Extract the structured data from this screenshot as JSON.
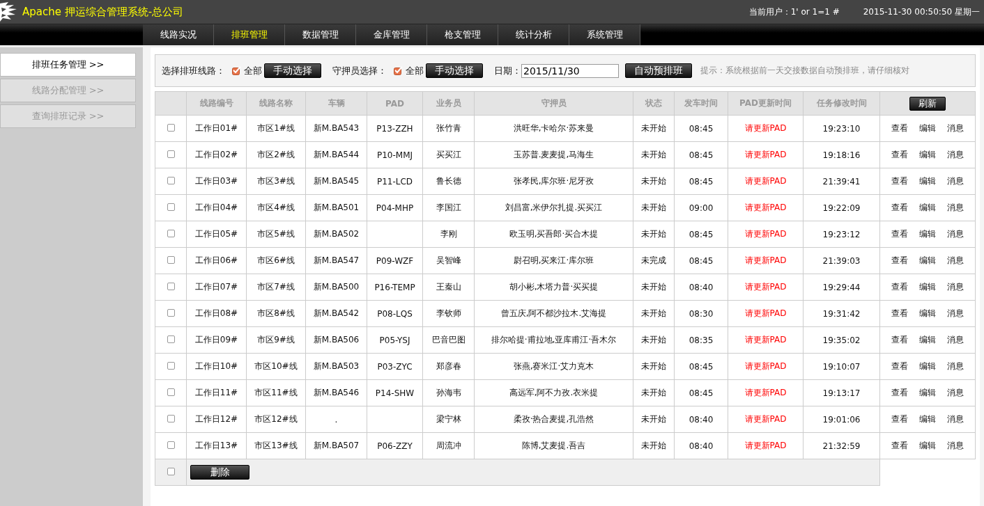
{
  "header": {
    "title": "Apache 押运综合管理系统-总公司",
    "user": "当前用户：1' or 1=1 #",
    "datetime": "2015-11-30 00:50:50 星期一"
  },
  "nav": [
    {
      "label": "线路实况",
      "selected": false
    },
    {
      "label": "排班管理",
      "selected": true
    },
    {
      "label": "数据管理",
      "selected": false
    },
    {
      "label": "金库管理",
      "selected": false
    },
    {
      "label": "枪支管理",
      "selected": false
    },
    {
      "label": "统计分析",
      "selected": false
    },
    {
      "label": "系统管理",
      "selected": false
    }
  ],
  "sidebar": {
    "items": [
      {
        "label": "排班任务管理 >>",
        "selected": true
      },
      {
        "label": "线路分配管理 >>",
        "selected": false
      },
      {
        "label": "查询排班记录 >>",
        "selected": false
      }
    ]
  },
  "filters": {
    "route_label": "选择排班线路：",
    "route_all": {
      "label": "全部",
      "checked": true
    },
    "route_button": "手动选择",
    "guard_label": "守押员选择：",
    "guard_all": {
      "label": "全部",
      "checked": true
    },
    "guard_button": "手动选择",
    "date_label": "日期：",
    "date_value": "2015/11/30",
    "auto_button": "自动预排班",
    "hint": "提示：系统根据前一天交接数据自动预排班，请仔细核对"
  },
  "table": {
    "columns": [
      "线路编号",
      "线路名称",
      "车辆",
      "PAD",
      "业务员",
      "守押员",
      "状态",
      "发车时间",
      "PAD更新时间",
      "任务修改时间"
    ],
    "refresh_button": "刷新",
    "rows": [
      {
        "checked": false,
        "cells": [
          "工作日01#",
          "市区1#线",
          "新M.BA543",
          "P13-ZZH",
          "张竹青",
          "洪旺华,卡哈尔·苏来曼",
          "未开始",
          "08:45",
          "请更新PAD",
          "19:23:10"
        ],
        "actions": [
          "查看",
          "编辑",
          "消息"
        ]
      },
      {
        "checked": false,
        "cells": [
          "工作日02#",
          "市区2#线",
          "新M.BA544",
          "P10-MMJ",
          "买买江",
          "玉苏普.麦麦提,马海生",
          "未开始",
          "08:45",
          "请更新PAD",
          "19:18:16"
        ],
        "actions": [
          "查看",
          "编辑",
          "消息"
        ]
      },
      {
        "checked": false,
        "cells": [
          "工作日03#",
          "市区3#线",
          "新M.BA545",
          "P11-LCD",
          "鲁长德",
          "张孝民,库尔班·尼牙孜",
          "未开始",
          "08:45",
          "请更新PAD",
          "21:39:41"
        ],
        "actions": [
          "查看",
          "编辑",
          "消息"
        ]
      },
      {
        "checked": false,
        "cells": [
          "工作日04#",
          "市区4#线",
          "新M.BA501",
          "P04-MHP",
          "李国江",
          "刘昌富,米伊尔扎提.买买江",
          "未开始",
          "09:00",
          "请更新PAD",
          "19:22:09"
        ],
        "actions": [
          "查看",
          "编辑",
          "消息"
        ]
      },
      {
        "checked": false,
        "cells": [
          "工作日05#",
          "市区5#线",
          "新M.BA502",
          null,
          "李刚",
          "欧玉明,买吾郎·买合木提",
          "未开始",
          "08:45",
          "请更新PAD",
          "19:23:12"
        ],
        "actions": [
          "查看",
          "编辑",
          "消息"
        ]
      },
      {
        "checked": false,
        "cells": [
          "工作日06#",
          "市区6#线",
          "新M.BA547",
          "P09-WZF",
          "吴智峰",
          "尉召明,买来江·库尔班",
          "未完成",
          "08:45",
          "请更新PAD",
          "21:39:03"
        ],
        "actions": [
          "查看",
          "编辑",
          "消息"
        ]
      },
      {
        "checked": false,
        "cells": [
          "工作日07#",
          "市区7#线",
          "新M.BA500",
          "P16-TEMP",
          "王秦山",
          "胡小彬,木塔力普·买买提",
          "未开始",
          "08:40",
          "请更新PAD",
          "19:29:44"
        ],
        "actions": [
          "查看",
          "编辑",
          "消息"
        ]
      },
      {
        "checked": false,
        "cells": [
          "工作日08#",
          "市区8#线",
          "新M.BA542",
          "P08-LQS",
          "李钦师",
          "曾五庆,阿不都沙拉木.艾海提",
          "未开始",
          "08:30",
          "请更新PAD",
          "19:31:42"
        ],
        "actions": [
          "查看",
          "编辑",
          "消息"
        ]
      },
      {
        "checked": false,
        "cells": [
          "工作日09#",
          "市区9#线",
          "新M.BA506",
          "P05-YSJ",
          "巴音巴图",
          "排尔哈提·甫拉地,亚库甫江·吾木尔",
          "未开始",
          "08:35",
          "请更新PAD",
          "19:35:02"
        ],
        "actions": [
          "查看",
          "编辑",
          "消息"
        ]
      },
      {
        "checked": false,
        "cells": [
          "工作日10#",
          "市区10#线",
          "新M.BA503",
          "P03-ZYC",
          "郑彦春",
          "张燕,赛米江·艾力克木",
          "未开始",
          "08:45",
          "请更新PAD",
          "19:10:07"
        ],
        "actions": [
          "查看",
          "编辑",
          "消息"
        ]
      },
      {
        "checked": false,
        "cells": [
          "工作日11#",
          "市区11#线",
          "新M.BA546",
          "P14-SHW",
          "孙海韦",
          "高远军,阿不力孜.衣米提",
          "未开始",
          "08:45",
          "请更新PAD",
          "19:13:17"
        ],
        "actions": [
          "查看",
          "编辑",
          "消息"
        ]
      },
      {
        "checked": false,
        "cells": [
          "工作日12#",
          "市区12#线",
          ".",
          null,
          "梁宁林",
          "柔孜·热合麦提,孔浩然",
          "未开始",
          "08:40",
          "请更新PAD",
          "19:01:06"
        ],
        "actions": [
          "查看",
          "编辑",
          "消息"
        ]
      },
      {
        "checked": false,
        "cells": [
          "工作日13#",
          "市区13#线",
          "新M.BA507",
          "P06-ZZY",
          "周流冲",
          "陈博,艾麦提.吾吉",
          "未开始",
          "08:40",
          "请更新PAD",
          "21:32:59"
        ],
        "actions": [
          "查看",
          "编辑",
          "消息"
        ]
      }
    ],
    "footer": {
      "checked": false,
      "delete_button": "删除"
    }
  }
}
